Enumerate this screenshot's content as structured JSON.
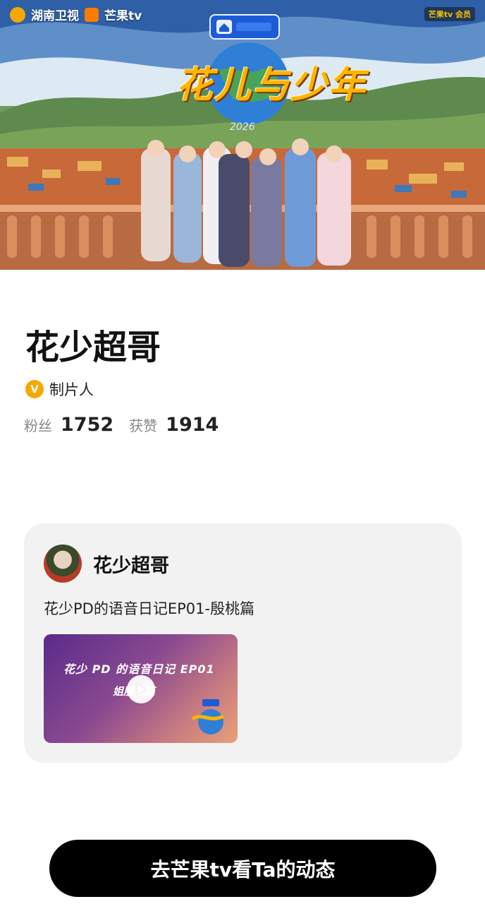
{
  "hero": {
    "brand_left_1": "湖南卫视",
    "brand_left_2": "芒果tv",
    "brand_right": "芒果tv 会员",
    "show_logo": "花儿与少年",
    "show_year": "2026"
  },
  "profile": {
    "name": "花少超哥",
    "role": "制片人",
    "verified_badge": "V",
    "fans_label": "粉丝",
    "fans_value": "1752",
    "likes_label": "获赞",
    "likes_value": "1914"
  },
  "post": {
    "author": "花少超哥",
    "text": "花少PD的语音日记EP01-殷桃篇",
    "video": {
      "title_line1": "花少 PD 的语音日记 EP01",
      "title_line2": "姐殷桃篇"
    }
  },
  "cta": {
    "label": "去芒果tv看Ta的动态"
  },
  "colors": {
    "cta_bg": "#000000",
    "card_bg": "#f2f2f2",
    "verified": "#f7a800"
  }
}
